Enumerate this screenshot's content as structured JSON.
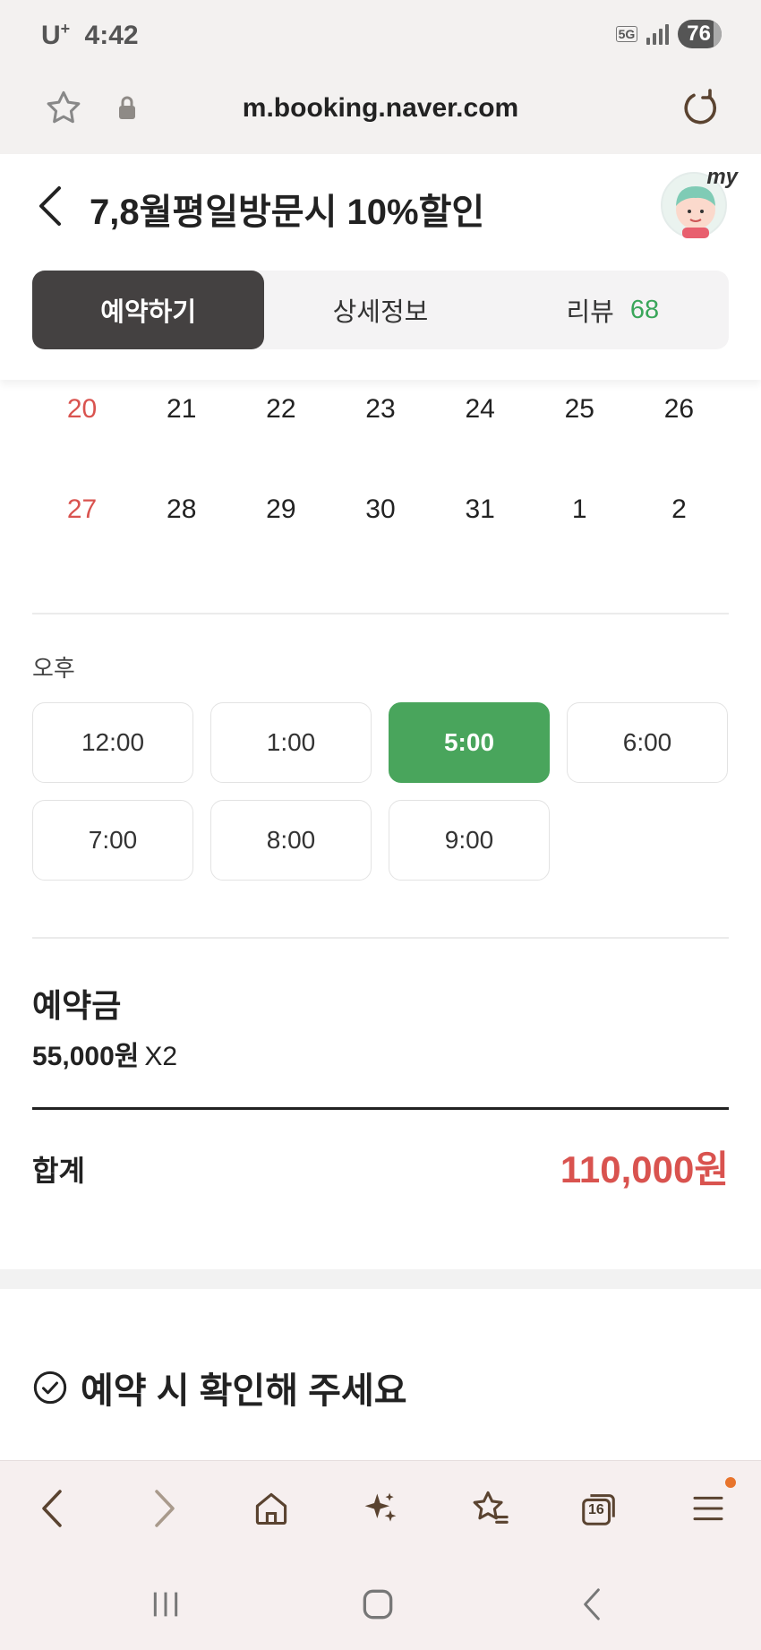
{
  "status_bar": {
    "carrier": "U",
    "carrier_sup": "+",
    "time": "4:42",
    "network": "5G",
    "battery": "76"
  },
  "browser": {
    "url": "m.booking.naver.com",
    "tab_count": "16"
  },
  "header": {
    "title": "7,8월평일방문시 10%할인",
    "avatar_label": "my"
  },
  "tabs": [
    {
      "label": "예약하기",
      "active": true
    },
    {
      "label": "상세정보",
      "active": false
    },
    {
      "label": "리뷰",
      "count": "68",
      "active": false
    }
  ],
  "calendar": {
    "weeks": [
      [
        "20",
        "21",
        "22",
        "23",
        "24",
        "25",
        "26"
      ],
      [
        "27",
        "28",
        "29",
        "30",
        "31",
        "1",
        "2"
      ]
    ]
  },
  "time_slots": {
    "period_label": "오후",
    "slots": [
      {
        "label": "12:00",
        "selected": false
      },
      {
        "label": "1:00",
        "selected": false
      },
      {
        "label": "5:00",
        "selected": true
      },
      {
        "label": "6:00",
        "selected": false
      },
      {
        "label": "7:00",
        "selected": false
      },
      {
        "label": "8:00",
        "selected": false
      },
      {
        "label": "9:00",
        "selected": false
      }
    ]
  },
  "price": {
    "deposit_label": "예약금",
    "deposit_amount": "55,000원",
    "multiplier": "X2",
    "total_label": "합계",
    "total_amount": "110,000원"
  },
  "notice": {
    "title": "예약 시 확인해 주세요"
  },
  "colors": {
    "accent_green": "#49a55c",
    "sunday_red": "#d9534f",
    "active_tab": "#444141",
    "total_red": "#d9534f"
  }
}
